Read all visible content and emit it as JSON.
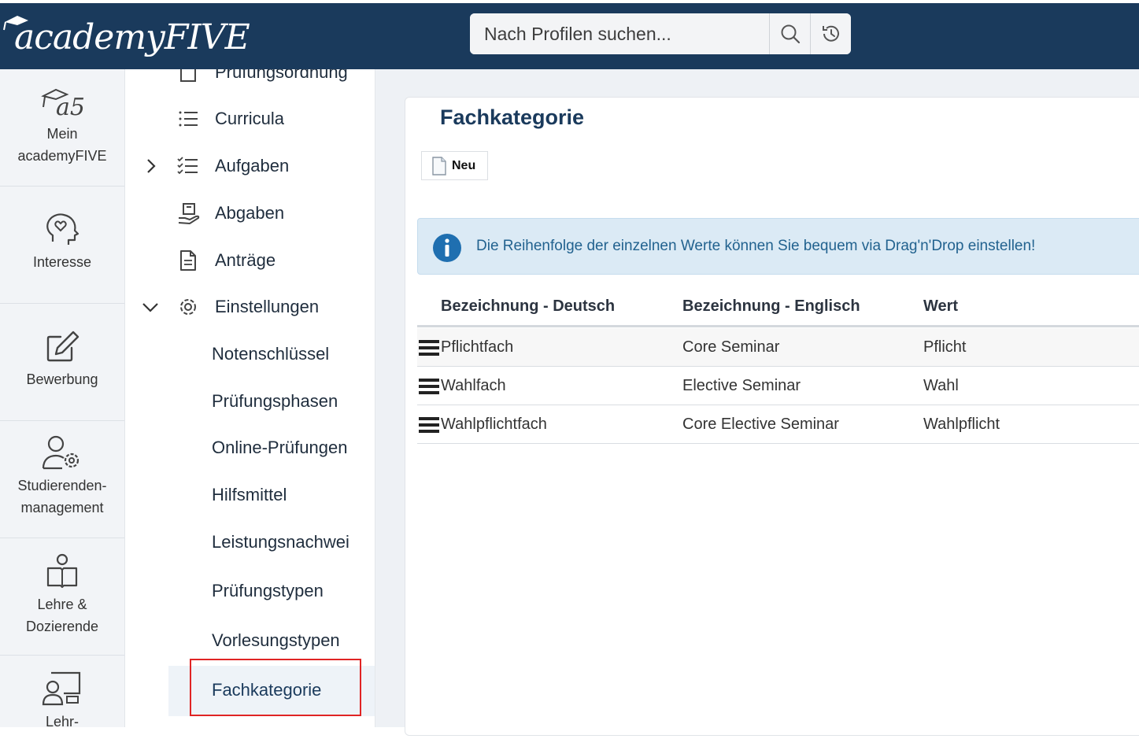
{
  "app": {
    "logo_text": "academyFIVE",
    "search": {
      "placeholder": "Nach Profilen suchen..."
    }
  },
  "rail": [
    {
      "icon": "graduation-hat-a5-icon",
      "label_line1": "Mein",
      "label_line2": "academyFIVE"
    },
    {
      "icon": "head-heart-icon",
      "label_line1": "Interesse",
      "label_line2": ""
    },
    {
      "icon": "edit-pen-icon",
      "label_line1": "Bewerbung",
      "label_line2": ""
    },
    {
      "icon": "user-gear-icon",
      "label_line1": "Studierenden-",
      "label_line2": "management"
    },
    {
      "icon": "reader-book-icon",
      "label_line1": "Lehre &",
      "label_line2": "Dozierende"
    },
    {
      "icon": "presenter-board-icon",
      "label_line1": "Lehr-",
      "label_line2": ""
    }
  ],
  "nav": {
    "items": [
      {
        "label": "Prüfungsordnung",
        "icon": "book-icon"
      },
      {
        "label": "Curricula",
        "icon": "list-icon"
      },
      {
        "label": "Aufgaben",
        "icon": "checklist-icon",
        "expand": "chevron-right-icon"
      },
      {
        "label": "Abgaben",
        "icon": "hand-box-icon"
      },
      {
        "label": "Anträge",
        "icon": "document-icon"
      },
      {
        "label": "Einstellungen",
        "icon": "gear-icon",
        "expand": "chevron-down-icon"
      }
    ],
    "sub_items": [
      "Notenschlüssel",
      "Prüfungsphasen",
      "Online-Prüfungen",
      "Hilfsmittel",
      "Leistungsnachwei",
      "Prüfungstypen",
      "Vorlesungstypen",
      "Fachkategorie"
    ],
    "active": "Fachkategorie"
  },
  "main": {
    "title": "Fachkategorie",
    "new_button": "Neu",
    "info_message": "Die Reihenfolge der einzelnen Werte können Sie bequem via Drag'n'Drop einstellen!",
    "table": {
      "headers": [
        "Bezeichnung - Deutsch",
        "Bezeichnung - Englisch",
        "Wert"
      ],
      "rows": [
        [
          "Pflichtfach",
          "Core Seminar",
          "Pflicht"
        ],
        [
          "Wahlfach",
          "Elective Seminar",
          "Wahl"
        ],
        [
          "Wahlpflichtfach",
          "Core Elective Seminar",
          "Wahlpflicht"
        ]
      ]
    }
  },
  "colors": {
    "topbar": "#1a3a5c",
    "accent": "#1a3a5c",
    "info_bg": "#dbeaf5",
    "info_text": "#22628f",
    "highlight": "#e02424"
  }
}
